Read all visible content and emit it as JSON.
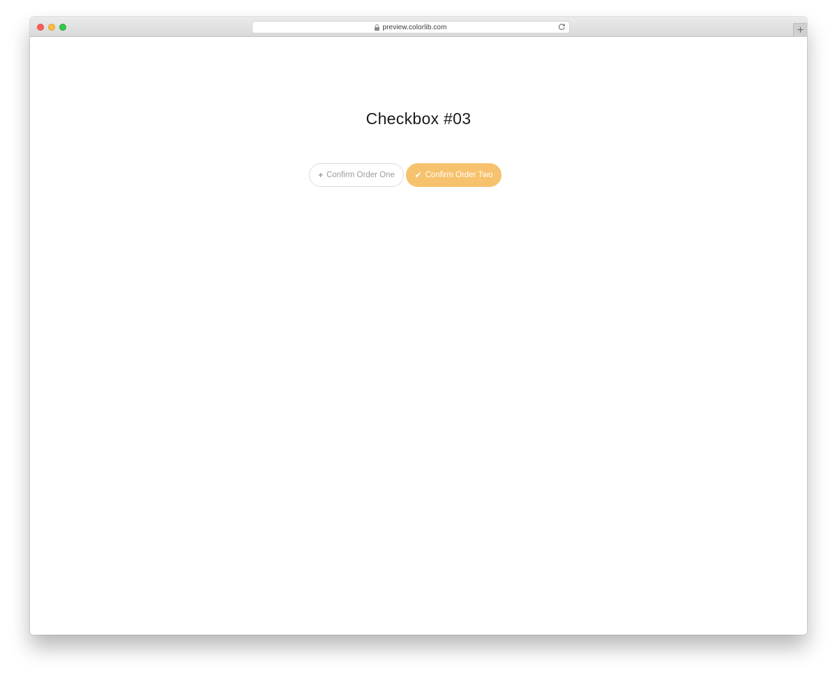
{
  "browser": {
    "url": "preview.colorlib.com",
    "new_tab_glyph": "+",
    "icons": {
      "lock": "lock-icon",
      "reload": "reload-icon"
    }
  },
  "page": {
    "title": "Checkbox #03"
  },
  "options": [
    {
      "label": "Confirm Order One",
      "checked": false,
      "icon": "plus-icon",
      "glyph": "+"
    },
    {
      "label": "Confirm Order Two",
      "checked": true,
      "icon": "check-icon",
      "glyph": "✔"
    }
  ],
  "colors": {
    "accent": "#f7c26d",
    "unchecked_border": "#dcdcdc",
    "unchecked_text": "#9b9b9b",
    "title_text": "#1a1a1a"
  }
}
